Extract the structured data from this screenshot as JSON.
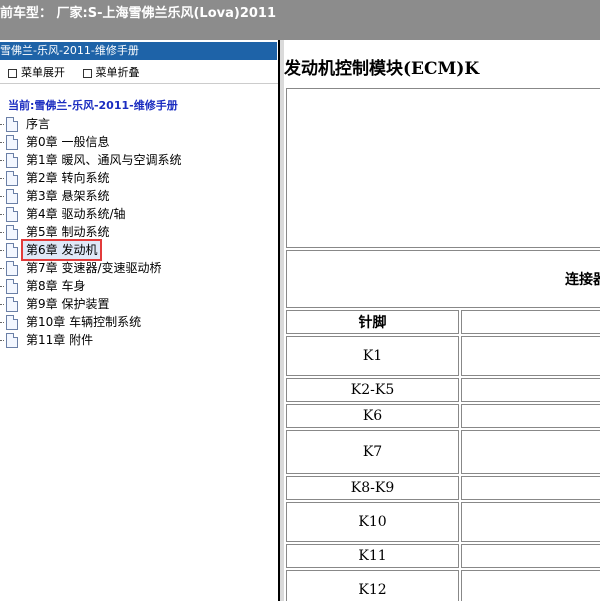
{
  "topbar": {
    "text": "前车型： 厂家:S-上海雪佛兰乐风(Lova)2011"
  },
  "leftpane": {
    "header": "雪佛兰-乐风-2011-维修手册",
    "tools": {
      "expand": "菜单展开",
      "collapse": "菜单折叠"
    },
    "root": "当前:雪佛兰-乐风-2011-维修手册",
    "items": [
      "序言",
      "第0章 一般信息",
      "第1章 暖风、通风与空调系统",
      "第2章 转向系统",
      "第3章 悬架系统",
      "第4章 驱动系统/轴",
      "第5章 制动系统",
      "第6章 发动机",
      "第7章 变速器/变速驱动桥",
      "第8章 车身",
      "第9章 保护装置",
      "第10章 车辆控制系统",
      "第11章 附件"
    ],
    "selected_index": 7
  },
  "rightpane": {
    "title": "发动机控制模块(ECM)K",
    "connector_caption": "连接器",
    "header_pin": "针脚",
    "rows": [
      "K1",
      "K2-K5",
      "K6",
      "K7",
      "K8-K9",
      "K10",
      "K11",
      "K12"
    ]
  }
}
